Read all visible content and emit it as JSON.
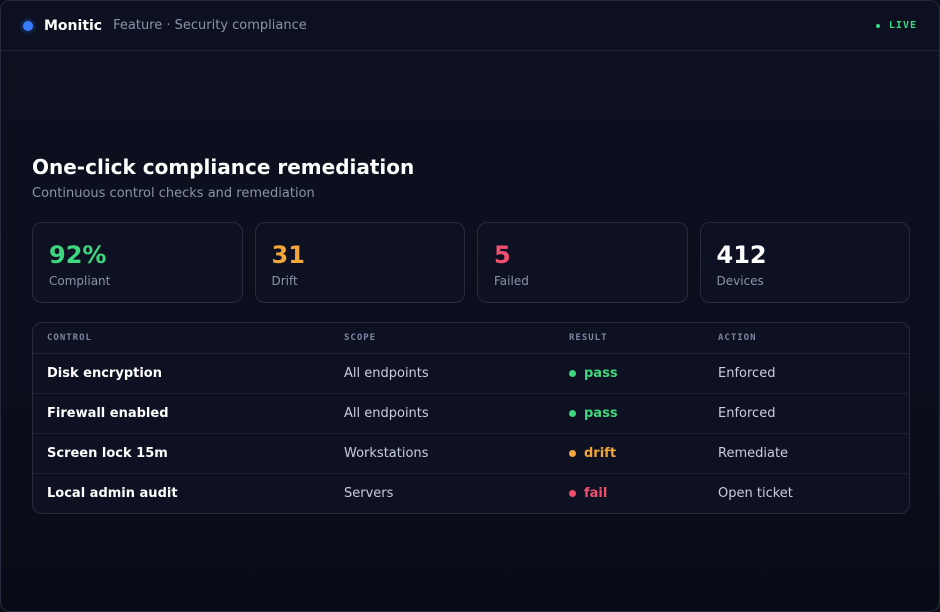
{
  "header": {
    "brand": "Monitic",
    "breadcrumb": "Feature · Security compliance",
    "status": "LIVE",
    "status_color": "#3ed67f",
    "brand_color": "#3b7bff"
  },
  "main": {
    "title": "One-click compliance remediation",
    "subtitle": "Continuous control checks and remediation"
  },
  "kpis": [
    {
      "value": "92%",
      "label": "Compliant",
      "color": "#3ed67f"
    },
    {
      "value": "31",
      "label": "Drift",
      "color": "#f2a63b"
    },
    {
      "value": "5",
      "label": "Failed",
      "color": "#f0506e"
    },
    {
      "value": "412",
      "label": "Devices",
      "color": "#ffffff"
    }
  ],
  "table": {
    "columns": [
      "CONTROL",
      "SCOPE",
      "RESULT",
      "ACTION"
    ],
    "rows": [
      {
        "control": "Disk encryption",
        "scope": "All endpoints",
        "result": "pass",
        "action": "Enforced"
      },
      {
        "control": "Firewall enabled",
        "scope": "All endpoints",
        "result": "pass",
        "action": "Enforced"
      },
      {
        "control": "Screen lock 15m",
        "scope": "Workstations",
        "result": "drift",
        "action": "Remediate"
      },
      {
        "control": "Local admin audit",
        "scope": "Servers",
        "result": "fail",
        "action": "Open ticket"
      }
    ]
  },
  "result_colors": {
    "pass": "#3ed67f",
    "drift": "#f2a63b",
    "fail": "#f0506e"
  }
}
